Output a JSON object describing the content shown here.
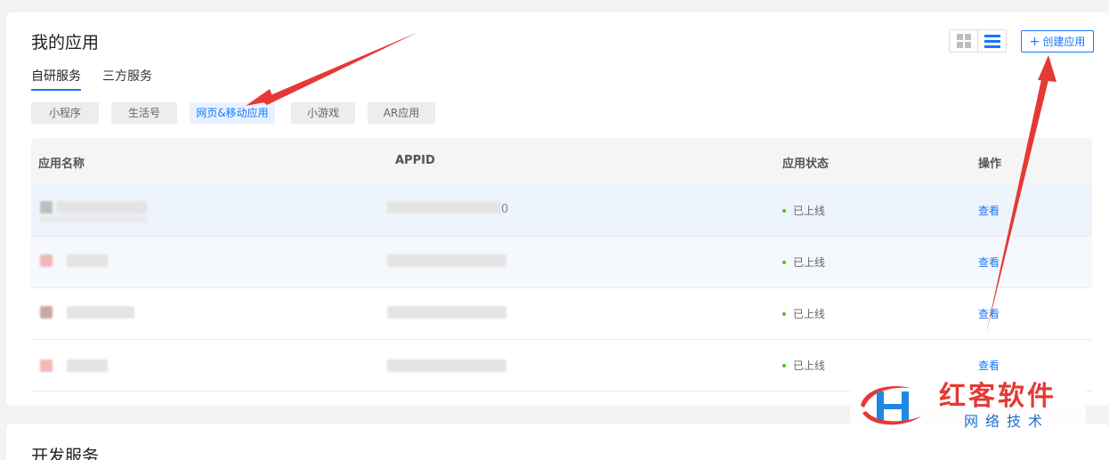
{
  "header": {
    "title": "我的应用",
    "create_label": "创建应用",
    "create_icon": "plus-icon",
    "view_grid_icon": "grid-view-icon",
    "view_list_icon": "list-view-icon"
  },
  "tabs": [
    {
      "label": "自研服务",
      "active": true
    },
    {
      "label": "三方服务",
      "active": false
    }
  ],
  "chips": [
    {
      "label": "小程序",
      "active": false
    },
    {
      "label": "生活号",
      "active": false
    },
    {
      "label": "网页&移动应用",
      "active": true
    },
    {
      "label": "小游戏",
      "active": false
    },
    {
      "label": "AR应用",
      "active": false
    }
  ],
  "table": {
    "columns": [
      "应用名称",
      "APPID",
      "应用状态",
      "操作"
    ],
    "rows": [
      {
        "appid_tail": "0",
        "status": "已上线",
        "action": "查看"
      },
      {
        "appid_tail": "",
        "status": "已上线",
        "action": "查看"
      },
      {
        "appid_tail": "",
        "status": "已上线",
        "action": "查看"
      },
      {
        "appid_tail": "",
        "status": "已上线",
        "action": "查看"
      }
    ]
  },
  "section2": {
    "title": "开发服务"
  },
  "watermark": {
    "main": "红客软件",
    "sub": "网络技术"
  },
  "colors": {
    "accent": "#1677ff",
    "status_online": "#52c41a",
    "arrow": "#e53935"
  }
}
